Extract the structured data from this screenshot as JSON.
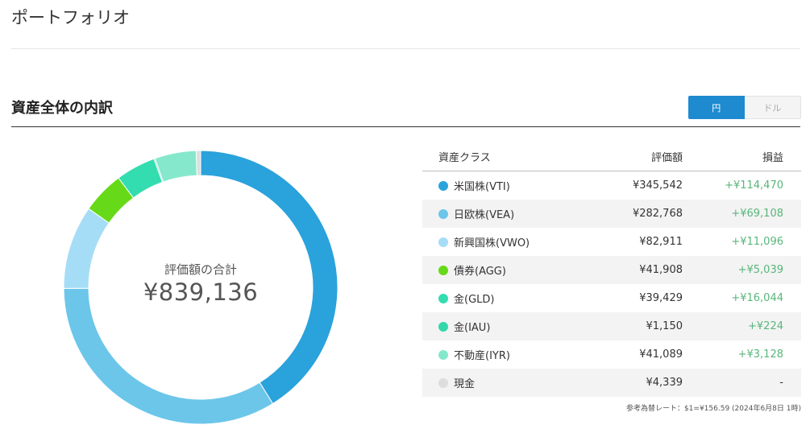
{
  "page": {
    "title": "ポートフォリオ"
  },
  "section": {
    "title": "資産全体の内訳"
  },
  "currency_toggle": {
    "yen_label": "円",
    "dollar_label": "ドル",
    "selected": "円"
  },
  "donut": {
    "center_label": "評価額の合計",
    "center_value": "¥839,136"
  },
  "table": {
    "headers": {
      "asset_class": "資産クラス",
      "value": "評価額",
      "gain": "損益"
    },
    "rows": [
      {
        "name": "米国株(VTI)",
        "value": "¥345,542",
        "gain": "+¥114,470",
        "color": "#2aa2dc"
      },
      {
        "name": "日欧株(VEA)",
        "value": "¥282,768",
        "gain": "+¥69,108",
        "color": "#6cc6ea"
      },
      {
        "name": "新興国株(VWO)",
        "value": "¥82,911",
        "gain": "+¥11,096",
        "color": "#a6ddf6"
      },
      {
        "name": "債券(AGG)",
        "value": "¥41,908",
        "gain": "+¥5,039",
        "color": "#66d918"
      },
      {
        "name": "金(GLD)",
        "value": "¥39,429",
        "gain": "+¥16,044",
        "color": "#33ddb0"
      },
      {
        "name": "金(IAU)",
        "value": "¥1,150",
        "gain": "+¥224",
        "color": "#33d7aa"
      },
      {
        "name": "不動産(IYR)",
        "value": "¥41,089",
        "gain": "+¥3,128",
        "color": "#85e8cd"
      },
      {
        "name": "現金",
        "value": "¥4,339",
        "gain": "-",
        "color": "#dddddd"
      }
    ]
  },
  "rate_note": "参考為替レート：$1=¥156.59 (2024年6月8日 1時)",
  "chart_data": {
    "type": "pie",
    "categories": [
      "米国株(VTI)",
      "日欧株(VEA)",
      "新興国株(VWO)",
      "債券(AGG)",
      "金(GLD)",
      "金(IAU)",
      "不動産(IYR)",
      "現金"
    ],
    "values": [
      345542,
      282768,
      82911,
      41908,
      39429,
      1150,
      41089,
      4339
    ],
    "colors": [
      "#2aa2dc",
      "#6cc6ea",
      "#a6ddf6",
      "#66d918",
      "#33ddb0",
      "#33d7aa",
      "#85e8cd",
      "#dddddd"
    ],
    "donut": true
  }
}
